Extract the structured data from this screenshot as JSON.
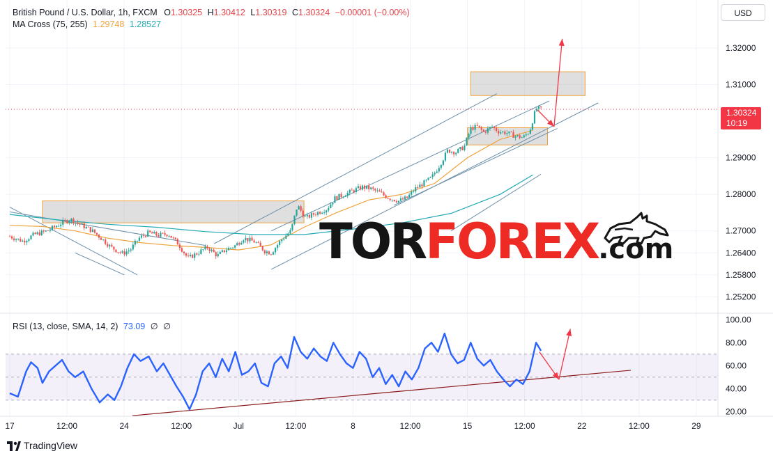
{
  "header": {
    "symbol": "British Pound / U.S. Dollar, 1h, FXCM",
    "o_label": "O",
    "o_value": "1.30325",
    "h_label": "H",
    "h_value": "1.30412",
    "l_label": "L",
    "l_value": "1.30319",
    "c_label": "C",
    "c_value": "1.30324",
    "change": "−0.00001 (−0.00%)",
    "ma_label": "MA Cross (75, 255)",
    "ma_fast": "1.29748",
    "ma_slow": "1.28527",
    "currency": "USD"
  },
  "last_price": {
    "value": "1.30324",
    "countdown": "10:19"
  },
  "rsi_header": {
    "label": "RSI (13, close, SMA, 14, 2)",
    "value": "73.09",
    "extra1": "∅",
    "extra2": "∅"
  },
  "watermark": {
    "part1": "TOR",
    "part2": "FOREX",
    "part3": ".com"
  },
  "branding": {
    "text": "TradingView"
  },
  "colors": {
    "up": "#26a69a",
    "down": "#ef5350",
    "ma_fast": "#f0a23b",
    "ma_slow": "#22aab5",
    "rsi": "#2962ff",
    "accent": "#e5434a"
  },
  "chart_data": [
    {
      "type": "candlestick",
      "title": "British Pound / U.S. Dollar, 1h, FXCM",
      "y_ticks": [
        "1.32000",
        "1.31000",
        "1.29000",
        "1.28000",
        "1.27000",
        "1.26400",
        "1.25800",
        "1.25200"
      ],
      "ylim": [
        1.2475,
        1.3255
      ],
      "x_ticks": [
        {
          "label": "17",
          "day": 0
        },
        {
          "label": "12:00",
          "day": 3.5
        },
        {
          "label": "24",
          "day": 7
        },
        {
          "label": "12:00",
          "day": 10.5
        },
        {
          "label": "Jul",
          "day": 14
        },
        {
          "label": "12:00",
          "day": 17.5
        },
        {
          "label": "8",
          "day": 21
        },
        {
          "label": "12:00",
          "day": 24.5
        },
        {
          "label": "15",
          "day": 28
        },
        {
          "label": "12:00",
          "day": 31.5
        },
        {
          "label": "22",
          "day": 35
        },
        {
          "label": "12:00",
          "day": 38.5
        },
        {
          "label": "29",
          "day": 42
        }
      ],
      "close_path": [
        [
          0.0,
          1.2685
        ],
        [
          0.8,
          1.2672
        ],
        [
          1.5,
          1.269
        ],
        [
          2.3,
          1.27
        ],
        [
          3.2,
          1.2722
        ],
        [
          3.7,
          1.2732
        ],
        [
          4.4,
          1.2715
        ],
        [
          5.0,
          1.2702
        ],
        [
          5.6,
          1.268
        ],
        [
          6.2,
          1.2655
        ],
        [
          6.9,
          1.2638
        ],
        [
          7.4,
          1.265
        ],
        [
          7.9,
          1.268
        ],
        [
          8.5,
          1.2695
        ],
        [
          9.1,
          1.2688
        ],
        [
          9.7,
          1.2692
        ],
        [
          10.3,
          1.2665
        ],
        [
          10.9,
          1.2625
        ],
        [
          11.5,
          1.264
        ],
        [
          12.1,
          1.2655
        ],
        [
          12.7,
          1.2632
        ],
        [
          13.2,
          1.2648
        ],
        [
          13.8,
          1.266
        ],
        [
          14.3,
          1.268
        ],
        [
          15.0,
          1.267
        ],
        [
          15.6,
          1.2645
        ],
        [
          16.0,
          1.264
        ],
        [
          16.6,
          1.2675
        ],
        [
          17.2,
          1.27
        ],
        [
          17.6,
          1.277
        ],
        [
          18.1,
          1.2735
        ],
        [
          18.7,
          1.2748
        ],
        [
          19.4,
          1.276
        ],
        [
          19.9,
          1.279
        ],
        [
          20.5,
          1.28
        ],
        [
          21.1,
          1.2812
        ],
        [
          21.6,
          1.282
        ],
        [
          22.1,
          1.2815
        ],
        [
          22.6,
          1.2805
        ],
        [
          23.2,
          1.279
        ],
        [
          23.8,
          1.2782
        ],
        [
          24.3,
          1.279
        ],
        [
          24.8,
          1.2815
        ],
        [
          25.3,
          1.283
        ],
        [
          25.8,
          1.2845
        ],
        [
          26.3,
          1.288
        ],
        [
          26.8,
          1.292
        ],
        [
          27.3,
          1.2915
        ],
        [
          27.8,
          1.293
        ],
        [
          28.2,
          1.298
        ],
        [
          28.6,
          1.2985
        ],
        [
          29.0,
          1.297
        ],
        [
          29.5,
          1.2985
        ],
        [
          29.9,
          1.2972
        ],
        [
          30.4,
          1.2968
        ],
        [
          30.9,
          1.296
        ],
        [
          31.4,
          1.2955
        ],
        [
          31.8,
          1.2972
        ],
        [
          32.2,
          1.3035
        ],
        [
          32.5,
          1.3032
        ]
      ],
      "series": [
        {
          "name": "MA Cross (75, 255)",
          "period": 75,
          "points": [
            [
              0,
              1.2715
            ],
            [
              2,
              1.2712
            ],
            [
              4,
              1.27
            ],
            [
              6,
              1.268
            ],
            [
              8,
              1.2668
            ],
            [
              10,
              1.266
            ],
            [
              12,
              1.2655
            ],
            [
              14,
              1.2648
            ],
            [
              16,
              1.2662
            ],
            [
              18,
              1.271
            ],
            [
              20,
              1.275
            ],
            [
              22,
              1.2785
            ],
            [
              24,
              1.28
            ],
            [
              26,
              1.283
            ],
            [
              28,
              1.29
            ],
            [
              30,
              1.295
            ],
            [
              32,
              1.2975
            ]
          ]
        },
        {
          "name": "MA Cross (75, 255)",
          "period": 255,
          "points": [
            [
              0,
              1.2745
            ],
            [
              3,
              1.273
            ],
            [
              6,
              1.2718
            ],
            [
              9,
              1.271
            ],
            [
              12,
              1.2698
            ],
            [
              15,
              1.269
            ],
            [
              18,
              1.269
            ],
            [
              21,
              1.2705
            ],
            [
              24,
              1.2722
            ],
            [
              27,
              1.2748
            ],
            [
              30,
              1.28
            ],
            [
              32,
              1.2853
            ]
          ]
        }
      ],
      "zones": [
        {
          "day_from": 2.0,
          "day_to": 18.0,
          "y_from": 1.2722,
          "y_to": 1.2782
        },
        {
          "day_from": 28.0,
          "day_to": 32.9,
          "y_from": 1.2935,
          "y_to": 1.2982
        },
        {
          "day_from": 28.2,
          "day_to": 35.2,
          "y_from": 1.307,
          "y_to": 1.3135
        }
      ],
      "channel_lines": [
        {
          "a": [
            0.0,
            1.2765
          ],
          "b": [
            7.8,
            1.258
          ]
        },
        {
          "a": [
            0.0,
            1.2752
          ],
          "b": [
            12.0,
            1.266
          ]
        },
        {
          "a": [
            4.0,
            1.264
          ],
          "b": [
            7.0,
            1.258
          ]
        },
        {
          "a": [
            16.0,
            1.27
          ],
          "b": [
            33.0,
            1.3055
          ]
        },
        {
          "a": [
            12.5,
            1.2665
          ],
          "b": [
            29.8,
            1.3075
          ]
        },
        {
          "a": [
            16.0,
            1.2595
          ],
          "b": [
            36.0,
            1.305
          ]
        },
        {
          "a": [
            23.5,
            1.277
          ],
          "b": [
            33.5,
            1.298
          ]
        },
        {
          "a": [
            27.0,
            1.27
          ],
          "b": [
            32.5,
            1.2855
          ]
        }
      ],
      "arrows": [
        {
          "from": [
            32.3,
            1.303
          ],
          "to": [
            33.3,
            1.2985
          ]
        },
        {
          "from": [
            33.3,
            1.2985
          ],
          "to": [
            33.8,
            1.3225
          ]
        }
      ],
      "current_price": 1.30324
    },
    {
      "type": "line",
      "title": "RSI (13, close, SMA, 14, 2)",
      "y_ticks": [
        "100.00",
        "80.00",
        "60.00",
        "40.00",
        "20.00"
      ],
      "ylim": [
        16,
        102
      ],
      "band": [
        30,
        70
      ],
      "points": [
        [
          0.0,
          36
        ],
        [
          0.5,
          33
        ],
        [
          1.0,
          55
        ],
        [
          1.3,
          63
        ],
        [
          1.7,
          58
        ],
        [
          2.0,
          45
        ],
        [
          2.4,
          55
        ],
        [
          2.8,
          60
        ],
        [
          3.2,
          65
        ],
        [
          3.6,
          55
        ],
        [
          4.0,
          50
        ],
        [
          4.5,
          55
        ],
        [
          5.0,
          40
        ],
        [
          5.5,
          28
        ],
        [
          6.0,
          35
        ],
        [
          6.4,
          30
        ],
        [
          6.8,
          42
        ],
        [
          7.2,
          58
        ],
        [
          7.6,
          70
        ],
        [
          8.0,
          64
        ],
        [
          8.5,
          68
        ],
        [
          9.0,
          55
        ],
        [
          9.4,
          62
        ],
        [
          9.8,
          52
        ],
        [
          10.2,
          42
        ],
        [
          10.6,
          33
        ],
        [
          11.0,
          22
        ],
        [
          11.4,
          35
        ],
        [
          11.8,
          55
        ],
        [
          12.2,
          62
        ],
        [
          12.6,
          50
        ],
        [
          13.0,
          66
        ],
        [
          13.4,
          55
        ],
        [
          13.8,
          72
        ],
        [
          14.2,
          52
        ],
        [
          14.6,
          55
        ],
        [
          15.0,
          62
        ],
        [
          15.4,
          45
        ],
        [
          15.8,
          42
        ],
        [
          16.2,
          62
        ],
        [
          16.6,
          68
        ],
        [
          17.0,
          58
        ],
        [
          17.4,
          85
        ],
        [
          17.8,
          72
        ],
        [
          18.2,
          66
        ],
        [
          18.6,
          75
        ],
        [
          19.0,
          68
        ],
        [
          19.4,
          64
        ],
        [
          19.8,
          80
        ],
        [
          20.2,
          70
        ],
        [
          20.6,
          62
        ],
        [
          21.0,
          58
        ],
        [
          21.4,
          72
        ],
        [
          21.8,
          66
        ],
        [
          22.2,
          50
        ],
        [
          22.6,
          58
        ],
        [
          23.0,
          44
        ],
        [
          23.4,
          52
        ],
        [
          23.8,
          42
        ],
        [
          24.2,
          55
        ],
        [
          24.6,
          48
        ],
        [
          25.0,
          58
        ],
        [
          25.4,
          75
        ],
        [
          25.8,
          80
        ],
        [
          26.2,
          72
        ],
        [
          26.6,
          88
        ],
        [
          27.0,
          70
        ],
        [
          27.4,
          62
        ],
        [
          27.8,
          65
        ],
        [
          28.2,
          80
        ],
        [
          28.6,
          66
        ],
        [
          29.0,
          60
        ],
        [
          29.4,
          65
        ],
        [
          29.8,
          55
        ],
        [
          30.2,
          48
        ],
        [
          30.6,
          42
        ],
        [
          31.0,
          48
        ],
        [
          31.4,
          44
        ],
        [
          31.8,
          55
        ],
        [
          32.2,
          80
        ],
        [
          32.5,
          73
        ]
      ],
      "trendline": {
        "a": [
          7.5,
          16.5
        ],
        "b": [
          38.0,
          56.0
        ]
      },
      "arrows": [
        {
          "from": [
            32.4,
            72
          ],
          "to": [
            33.6,
            48
          ]
        },
        {
          "from": [
            33.6,
            48
          ],
          "to": [
            34.3,
            92
          ]
        }
      ],
      "current_value": 73.09
    }
  ]
}
